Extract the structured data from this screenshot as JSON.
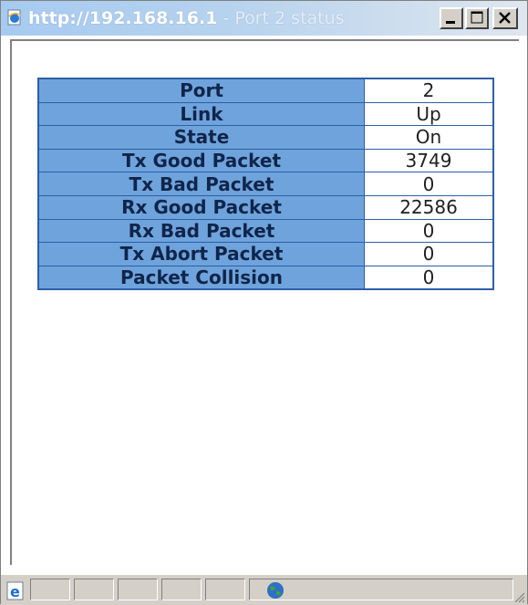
{
  "window": {
    "title_url": "http://192.168.16.1",
    "title_suffix": " - Port 2 status",
    "buttons": {
      "minimize": "minimize",
      "maximize": "maximize",
      "close": "close"
    }
  },
  "status_table": {
    "rows": [
      {
        "label": "Port",
        "value": "2"
      },
      {
        "label": "Link",
        "value": "Up"
      },
      {
        "label": "State",
        "value": "On"
      },
      {
        "label": "Tx Good Packet",
        "value": "3749"
      },
      {
        "label": "Tx Bad Packet",
        "value": "0"
      },
      {
        "label": "Rx Good Packet",
        "value": "22586"
      },
      {
        "label": "Rx Bad Packet",
        "value": "0"
      },
      {
        "label": "Tx Abort Packet",
        "value": "0"
      },
      {
        "label": "Packet Collision",
        "value": "0"
      }
    ]
  },
  "icons": {
    "title": "ie-page-icon",
    "statusbar_left": "ie-e-icon",
    "statusbar_zone": "internet-globe-icon",
    "grip": "resize-grip-icon"
  },
  "colors": {
    "label_cell": "#6fa3dc",
    "table_border": "#2d5ea8",
    "titlebar_start": "#a6caf0"
  }
}
